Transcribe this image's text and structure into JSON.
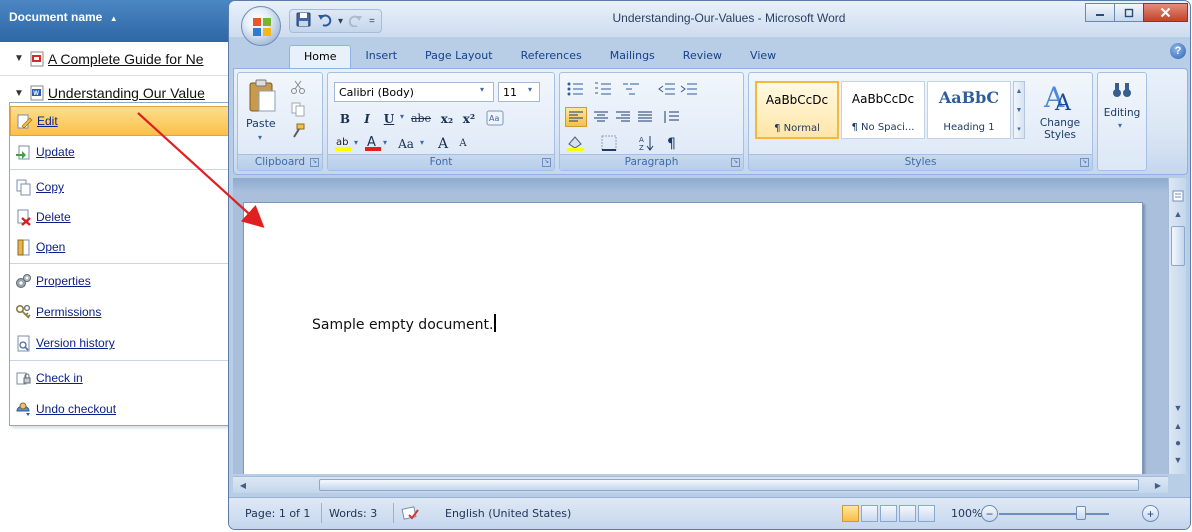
{
  "doclist": {
    "header": "Document name",
    "sort_indicator": "▲",
    "rows": [
      {
        "expander": "▼",
        "name": "A Complete Guide for Ne"
      },
      {
        "expander": "▼",
        "name": "Understanding Our Value"
      }
    ]
  },
  "context_menu": {
    "items": [
      {
        "label": "Edit"
      },
      {
        "label": "Update"
      },
      {
        "label": "Copy"
      },
      {
        "label": "Delete"
      },
      {
        "label": "Open"
      },
      {
        "label": "Properties"
      },
      {
        "label": "Permissions"
      },
      {
        "label": "Version history"
      },
      {
        "label": "Check in"
      },
      {
        "label": "Undo checkout"
      }
    ]
  },
  "word": {
    "title": "Understanding-Our-Values - Microsoft Word",
    "qat": {
      "undo_dropdown": "▾",
      "customize": "="
    },
    "tabs": [
      "Home",
      "Insert",
      "Page Layout",
      "References",
      "Mailings",
      "Review",
      "View"
    ],
    "help": "?",
    "ribbon": {
      "clipboard": {
        "paste": "Paste",
        "label": "Clipboard"
      },
      "font": {
        "family": "Calibri (Body)",
        "size": "11",
        "bold": "B",
        "italic": "I",
        "underline": "U",
        "strike": "abe",
        "subscript": "x₂",
        "superscript": "x²",
        "change_case": "Aa",
        "grow": "A",
        "shrink": "A",
        "label": "Font"
      },
      "paragraph": {
        "label": "Paragraph"
      },
      "styles": {
        "items": [
          {
            "sample": "AaBbCcDc",
            "name": "¶ Normal"
          },
          {
            "sample": "AaBbCcDc",
            "name": "¶ No Spaci..."
          },
          {
            "sample": "AaBbC",
            "name": "Heading 1"
          }
        ],
        "change_styles": "Change Styles",
        "label": "Styles"
      },
      "editing": {
        "label": "Editing"
      }
    },
    "document": {
      "text": "Sample empty document."
    },
    "status": {
      "page": "Page: 1 of 1",
      "words": "Words: 3",
      "language": "English (United States)",
      "zoom": "100%"
    },
    "colors": {
      "accent_blue": "#2d67a5",
      "arrow_red": "#e02020",
      "menu_highlight": "#fbc04a"
    }
  }
}
